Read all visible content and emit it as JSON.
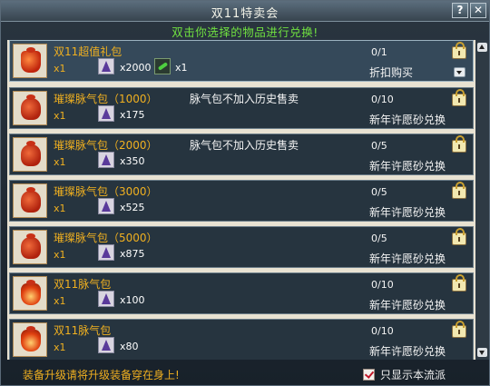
{
  "window": {
    "title": "双11特卖会",
    "hint": "双击你选择的物品进行兑换!",
    "help_label": "?",
    "close_label": "✕"
  },
  "items": [
    {
      "name": "双11超值礼包",
      "qty": "x1",
      "cost1_amount": "x2000",
      "cost2_amount": "x1",
      "note": "",
      "stock": "0/1",
      "method": "折扣购买",
      "icon": "gift-bag-icon"
    },
    {
      "name": "璀璨脉气包（1000）",
      "qty": "x1",
      "cost1_amount": "x175",
      "cost2_amount": "",
      "note": "脉气包不加入历史售卖",
      "stock": "0/10",
      "method": "新年许愿砂兑换",
      "icon": "pulse-bag-icon"
    },
    {
      "name": "璀璨脉气包（2000）",
      "qty": "x1",
      "cost1_amount": "x350",
      "cost2_amount": "",
      "note": "脉气包不加入历史售卖",
      "stock": "0/5",
      "method": "新年许愿砂兑换",
      "icon": "pulse-bag-icon"
    },
    {
      "name": "璀璨脉气包（3000）",
      "qty": "x1",
      "cost1_amount": "x525",
      "cost2_amount": "",
      "note": "",
      "stock": "0/5",
      "method": "新年许愿砂兑换",
      "icon": "pulse-bag-icon"
    },
    {
      "name": "璀璨脉气包（5000）",
      "qty": "x1",
      "cost1_amount": "x875",
      "cost2_amount": "",
      "note": "",
      "stock": "0/5",
      "method": "新年许愿砂兑换",
      "icon": "pulse-bag-icon"
    },
    {
      "name": "双11脉气包",
      "qty": "x1",
      "cost1_amount": "x100",
      "cost2_amount": "",
      "note": "",
      "stock": "0/10",
      "method": "新年许愿砂兑换",
      "icon": "flame-bag-icon"
    },
    {
      "name": "双11脉气包",
      "qty": "x1",
      "cost1_amount": "x80",
      "cost2_amount": "",
      "note": "",
      "stock": "0/10",
      "method": "新年许愿砂兑换",
      "icon": "flame-bag-icon"
    }
  ],
  "footer": {
    "tip": "装备升级请将升级装备穿在身上!",
    "checkbox_label": "只显示本流派",
    "checkbox_checked": true
  }
}
